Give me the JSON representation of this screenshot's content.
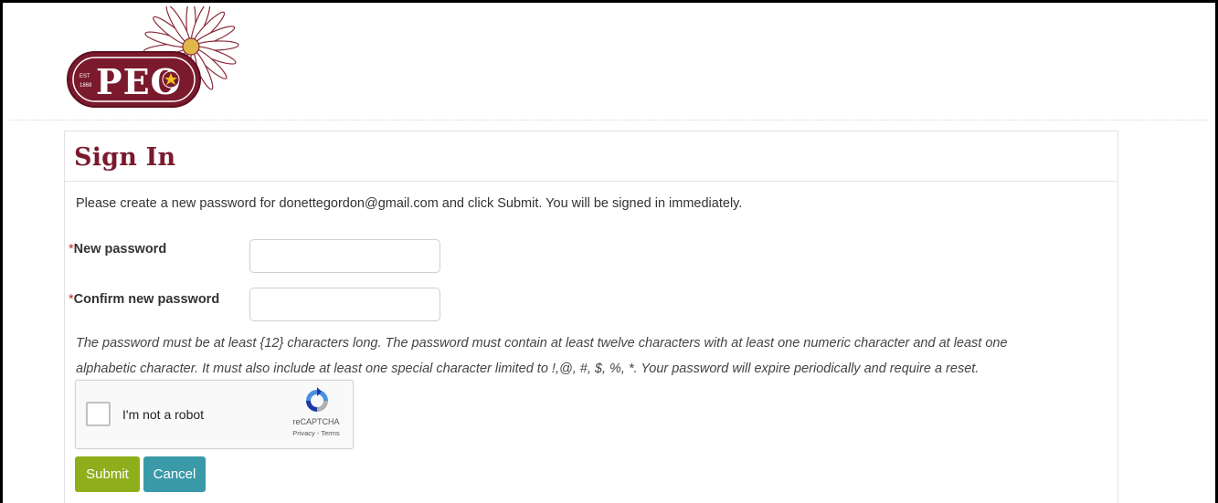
{
  "logo": {
    "text": "PEO"
  },
  "signin": {
    "title": "Sign In",
    "intro": "Please create a new password for donettegordon@gmail.com and click Submit. You will be signed in immediately.",
    "fields": [
      {
        "required_mark": "*",
        "label": "New password",
        "value": "",
        "placeholder": ""
      },
      {
        "required_mark": "*",
        "label": "Confirm new password",
        "value": "",
        "placeholder": ""
      }
    ],
    "help_line1": "The password must be at least {12} characters long. The password must contain at least twelve characters with at least one numeric character and at least one",
    "help_line2": "alphabetic character. It must also include at least one special character limited to !,@, #, $, %, *. Your password will expire periodically and require a reset.",
    "captcha": {
      "label": "I'm not a robot",
      "brand": "reCAPTCHA",
      "links": "Privacy - Terms",
      "checked": false
    },
    "buttons": {
      "submit": "Submit",
      "cancel": "Cancel"
    }
  },
  "colors": {
    "brand_maroon": "#7a1a2c",
    "submit_green": "#8fae1b",
    "cancel_teal": "#3b9aa8",
    "required_red": "#c62828"
  }
}
